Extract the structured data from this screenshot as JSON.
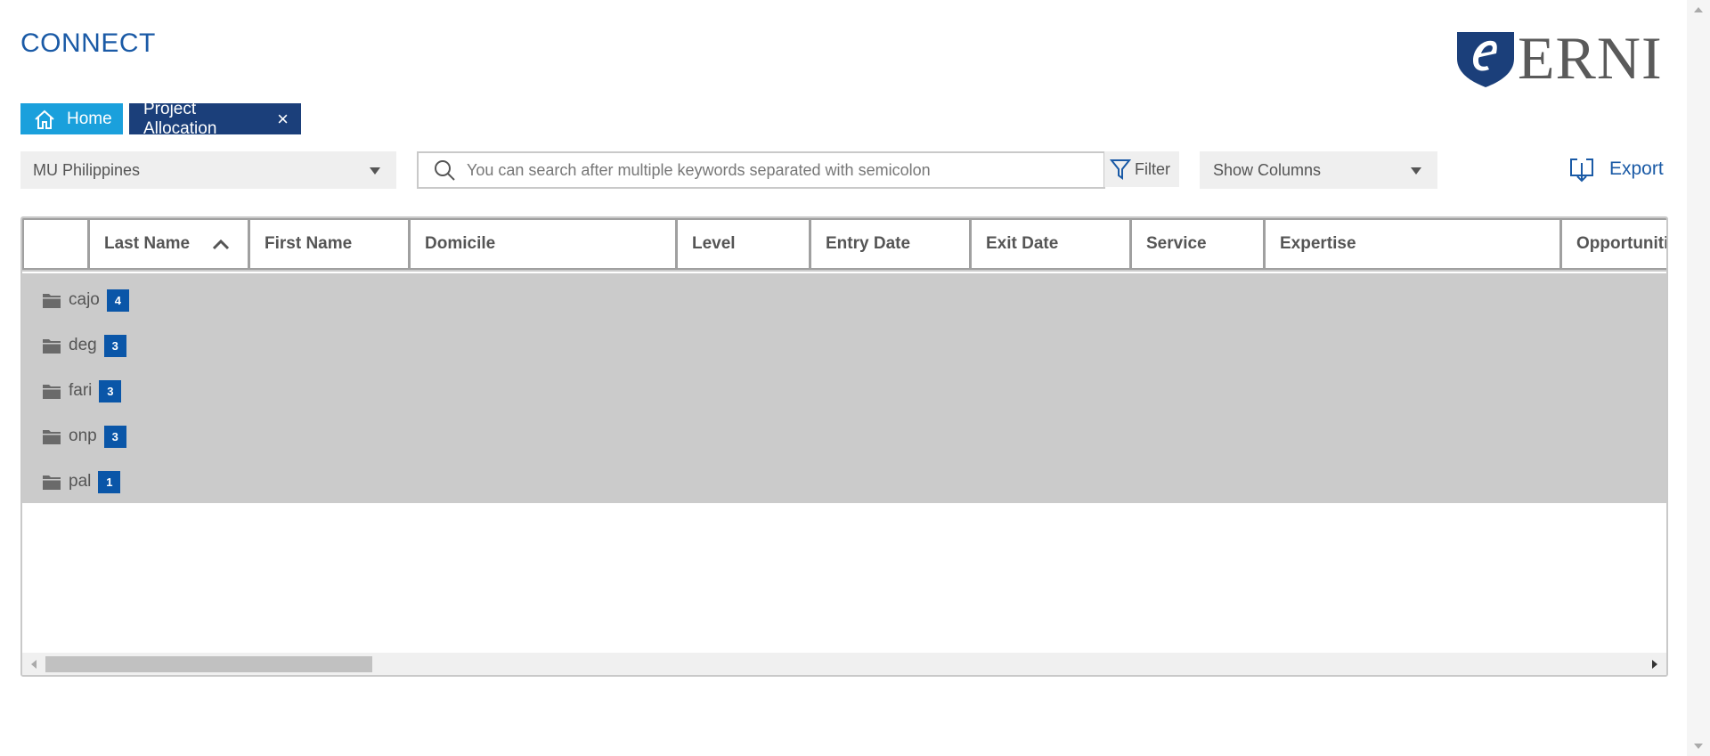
{
  "app": {
    "title": "CONNECT"
  },
  "logo": {
    "text": "ERNI"
  },
  "tabs": [
    {
      "label": "Home",
      "icon": "home-icon"
    },
    {
      "label": "Project Allocation",
      "close_icon": "×"
    }
  ],
  "toolbar": {
    "mu_dropdown": {
      "selected": "MU Philippines"
    },
    "search": {
      "placeholder": "You can search after multiple keywords separated with semicolon",
      "value": ""
    },
    "filter_label": "Filter",
    "show_columns": {
      "selected": "Show Columns"
    },
    "export_label": "Export"
  },
  "grid": {
    "columns": [
      "",
      "Last Name",
      "First Name",
      "Domicile",
      "Level",
      "Entry Date",
      "Exit Date",
      "Service",
      "Expertise",
      "Opportuniti"
    ],
    "sorted_column": "Last Name",
    "sort_direction": "ascending",
    "groups": [
      {
        "name": "cajo",
        "count": "4"
      },
      {
        "name": "deg",
        "count": "3"
      },
      {
        "name": "fari",
        "count": "3"
      },
      {
        "name": "onp",
        "count": "3"
      },
      {
        "name": "pal",
        "count": "1"
      }
    ]
  },
  "colors": {
    "brand_blue": "#1a5aa6",
    "home_tab": "#1aa0dc",
    "active_tab": "#1b3f7a",
    "badge": "#0a56a8",
    "group_bg": "#cbcbcb"
  }
}
